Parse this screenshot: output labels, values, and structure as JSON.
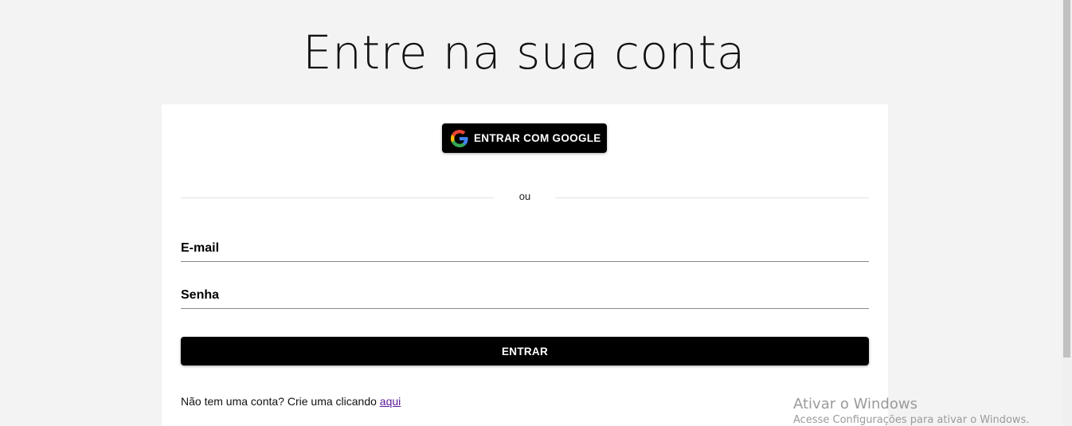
{
  "page": {
    "title": "Entre na sua conta"
  },
  "login": {
    "google_button_label": "ENTRAR COM GOOGLE",
    "google_icon": "google-g-logo",
    "divider_text": "ou",
    "email_label": "E-mail",
    "password_label": "Senha",
    "submit_label": "ENTRAR",
    "signup_text": "Não tem uma conta? Crie uma clicando ",
    "signup_link": "aqui"
  },
  "watermark": {
    "title": "Ativar o Windows",
    "subtitle": "Acesse Configurações para ativar o Windows."
  },
  "colors": {
    "background": "#f3f3f3",
    "card": "#ffffff",
    "button": "#000000",
    "link": "#5a1a9a"
  }
}
